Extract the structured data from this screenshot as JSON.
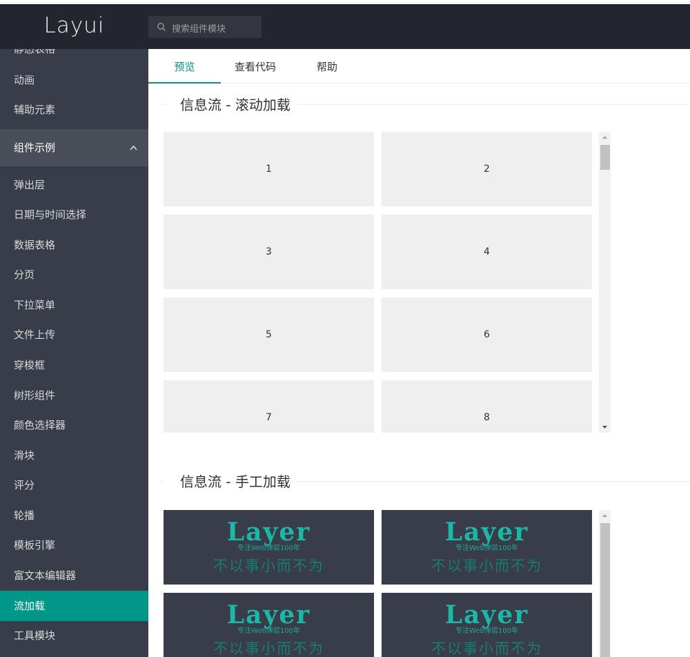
{
  "header": {
    "logo": "Layui",
    "search_placeholder": "搜索组件模块"
  },
  "sidebar": {
    "items": [
      {
        "label": "静态表格"
      },
      {
        "label": "动画"
      },
      {
        "label": "辅助元素"
      },
      {
        "label": "组件示例"
      },
      {
        "label": "弹出层"
      },
      {
        "label": "日期与时间选择"
      },
      {
        "label": "数据表格"
      },
      {
        "label": "分页"
      },
      {
        "label": "下拉菜单"
      },
      {
        "label": "文件上传"
      },
      {
        "label": "穿梭框"
      },
      {
        "label": "树形组件"
      },
      {
        "label": "颜色选择器"
      },
      {
        "label": "滑块"
      },
      {
        "label": "评分"
      },
      {
        "label": "轮播"
      },
      {
        "label": "模板引擎"
      },
      {
        "label": "富文本编辑器"
      },
      {
        "label": "流加载"
      },
      {
        "label": "工具模块"
      }
    ],
    "active_item": "流加载",
    "expanded_group": "组件示例"
  },
  "tabs": [
    {
      "label": "预览"
    },
    {
      "label": "查看代码"
    },
    {
      "label": "帮助"
    }
  ],
  "active_tab": "预览",
  "sections": {
    "scroll": {
      "title": "信息流 - 滚动加载",
      "tiles": [
        "1",
        "2",
        "3",
        "4",
        "5",
        "6",
        "7",
        "8"
      ]
    },
    "manual": {
      "title": "信息流 - 手工加载",
      "image": {
        "brand": "Layer",
        "subtitle": "专注Web弹层100年",
        "slogan": "不以事小而不为"
      }
    }
  },
  "colors": {
    "header_bg": "#23262e",
    "sidebar_bg": "#393d49",
    "active_bg": "#009688",
    "accent": "#009688",
    "tile_bg": "#efefef"
  }
}
